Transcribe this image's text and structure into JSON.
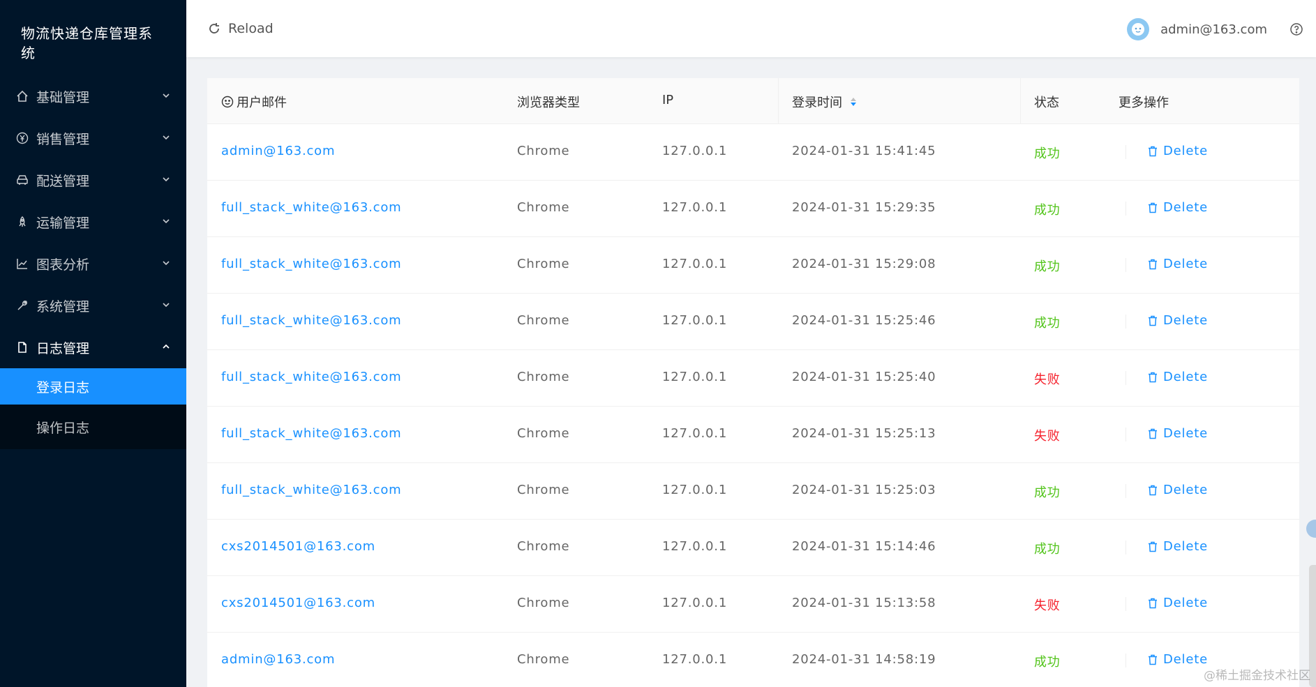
{
  "app": {
    "title": "物流快递仓库管理系统"
  },
  "sidebar": {
    "items": [
      {
        "label": "基础管理",
        "icon": "home-icon"
      },
      {
        "label": "销售管理",
        "icon": "yen-icon"
      },
      {
        "label": "配送管理",
        "icon": "car-icon"
      },
      {
        "label": "运输管理",
        "icon": "rocket-icon"
      },
      {
        "label": "图表分析",
        "icon": "line-chart-icon"
      },
      {
        "label": "系统管理",
        "icon": "tool-icon"
      },
      {
        "label": "日志管理",
        "icon": "file-icon"
      }
    ],
    "sub_items": [
      {
        "label": "登录日志"
      },
      {
        "label": "操作日志"
      }
    ]
  },
  "header": {
    "reload_label": "Reload",
    "user": "admin@163.com"
  },
  "table": {
    "headers": {
      "email": "用户邮件",
      "browser": "浏览器类型",
      "ip": "IP",
      "time": "登录时间",
      "status": "状态",
      "actions": "更多操作"
    },
    "delete_label": "Delete",
    "rows": [
      {
        "email": "admin@163.com",
        "browser": "Chrome",
        "ip": "127.0.0.1",
        "time": "2024-01-31 15:41:45",
        "status": "成功"
      },
      {
        "email": "full_stack_white@163.com",
        "browser": "Chrome",
        "ip": "127.0.0.1",
        "time": "2024-01-31 15:29:35",
        "status": "成功"
      },
      {
        "email": "full_stack_white@163.com",
        "browser": "Chrome",
        "ip": "127.0.0.1",
        "time": "2024-01-31 15:29:08",
        "status": "成功"
      },
      {
        "email": "full_stack_white@163.com",
        "browser": "Chrome",
        "ip": "127.0.0.1",
        "time": "2024-01-31 15:25:46",
        "status": "成功"
      },
      {
        "email": "full_stack_white@163.com",
        "browser": "Chrome",
        "ip": "127.0.0.1",
        "time": "2024-01-31 15:25:40",
        "status": "失败"
      },
      {
        "email": "full_stack_white@163.com",
        "browser": "Chrome",
        "ip": "127.0.0.1",
        "time": "2024-01-31 15:25:13",
        "status": "失败"
      },
      {
        "email": "full_stack_white@163.com",
        "browser": "Chrome",
        "ip": "127.0.0.1",
        "time": "2024-01-31 15:25:03",
        "status": "成功"
      },
      {
        "email": "cxs2014501@163.com",
        "browser": "Chrome",
        "ip": "127.0.0.1",
        "time": "2024-01-31 15:14:46",
        "status": "成功"
      },
      {
        "email": "cxs2014501@163.com",
        "browser": "Chrome",
        "ip": "127.0.0.1",
        "time": "2024-01-31 15:13:58",
        "status": "失败"
      },
      {
        "email": "admin@163.com",
        "browser": "Chrome",
        "ip": "127.0.0.1",
        "time": "2024-01-31 14:58:19",
        "status": "成功"
      }
    ]
  },
  "watermark": "@稀土掘金技术社区",
  "colors": {
    "primary": "#1890ff",
    "success": "#52c41a",
    "error": "#f5222d",
    "sidebar": "#001529"
  }
}
